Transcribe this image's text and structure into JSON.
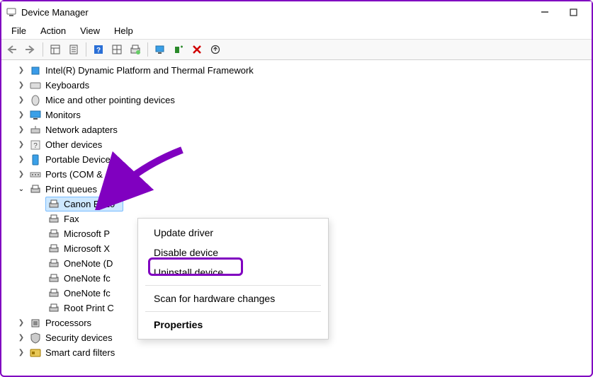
{
  "window": {
    "title": "Device Manager"
  },
  "menubar": {
    "file": "File",
    "action": "Action",
    "view": "View",
    "help": "Help"
  },
  "tree": {
    "intel": "Intel(R) Dynamic Platform and Thermal Framework",
    "keyboards": "Keyboards",
    "mice": "Mice and other pointing devices",
    "monitors": "Monitors",
    "network": "Network adapters",
    "other": "Other devices",
    "portable": "Portable Devices",
    "ports": "Ports (COM &",
    "printqueues": "Print queues",
    "processors": "Processors",
    "security": "Security devices",
    "smartcard": "Smart card filters"
  },
  "print_children": {
    "canon": "Canon E510",
    "fax": "Fax",
    "msp": "Microsoft P",
    "msx": "Microsoft X",
    "onenote_d": "OneNote (D",
    "onenote_fc1": "OneNote fc",
    "onenote_fc2": "OneNote fc",
    "root": "Root Print C"
  },
  "context_menu": {
    "update": "Update driver",
    "disable": "Disable device",
    "uninstall": "Uninstall device",
    "scan": "Scan for hardware changes",
    "properties": "Properties"
  }
}
